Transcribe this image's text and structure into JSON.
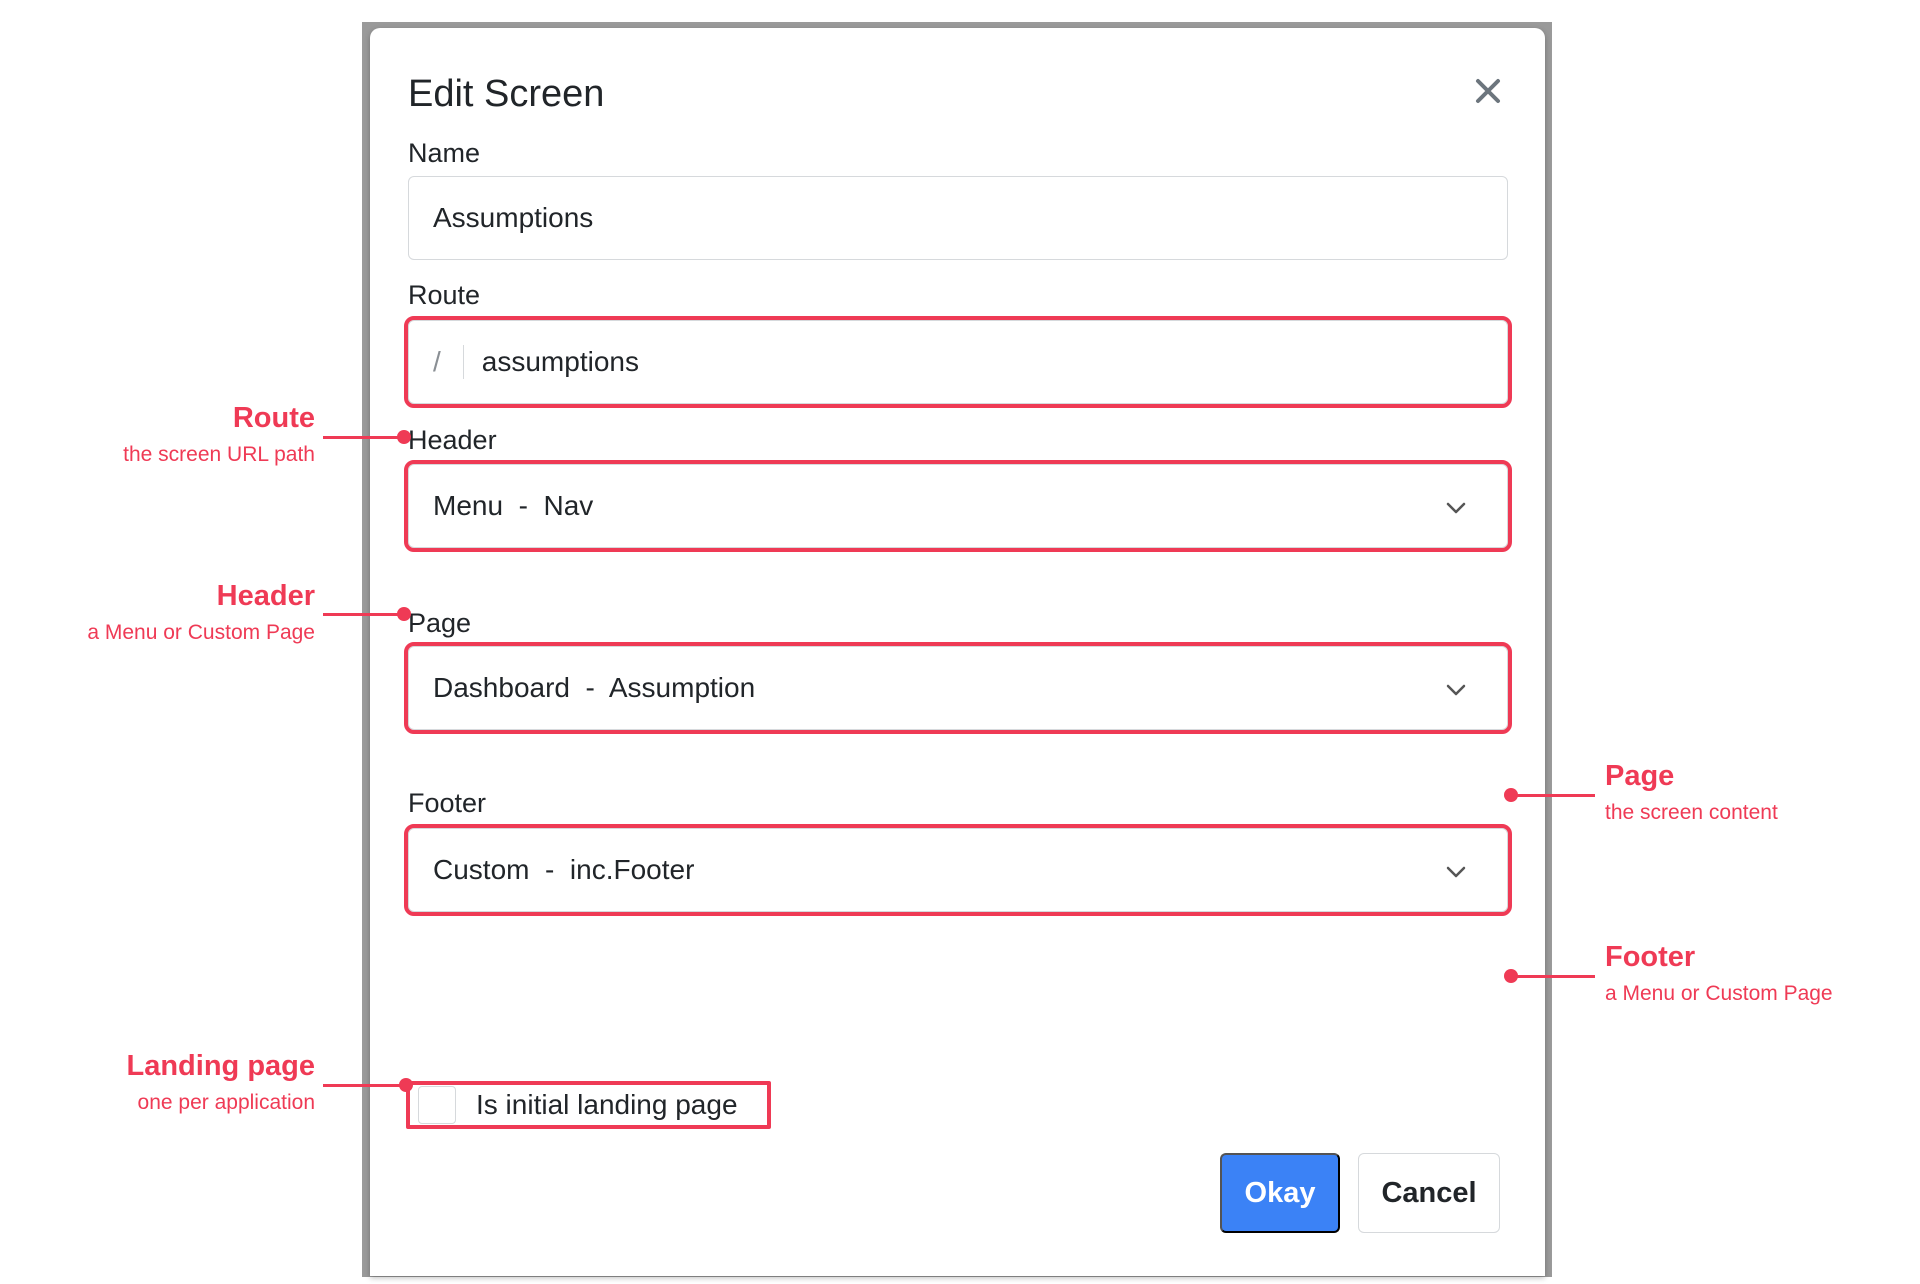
{
  "dialog": {
    "title": "Edit Screen",
    "close_icon": "close-icon"
  },
  "fields": {
    "name": {
      "label": "Name",
      "value": "Assumptions"
    },
    "route": {
      "label": "Route",
      "prefix": "/",
      "value": "assumptions"
    },
    "header": {
      "label": "Header",
      "value": "Menu  -  Nav"
    },
    "page": {
      "label": "Page",
      "value": "Dashboard  -  Assumption"
    },
    "footer": {
      "label": "Footer",
      "value": "Custom  -  inc.Footer"
    },
    "landing": {
      "label": "Is initial landing page",
      "checked": false
    }
  },
  "buttons": {
    "okay": "Okay",
    "cancel": "Cancel"
  },
  "annotations": {
    "route": {
      "title": "Route",
      "subtitle": "the screen URL path"
    },
    "header": {
      "title": "Header",
      "subtitle": "a Menu or Custom Page"
    },
    "page": {
      "title": "Page",
      "subtitle": "the screen content"
    },
    "footer": {
      "title": "Footer",
      "subtitle": "a Menu or Custom Page"
    },
    "landing": {
      "title": "Landing page",
      "subtitle": "one per application"
    }
  },
  "colors": {
    "highlight": "#ef3a55",
    "primary": "#3b82f6"
  }
}
